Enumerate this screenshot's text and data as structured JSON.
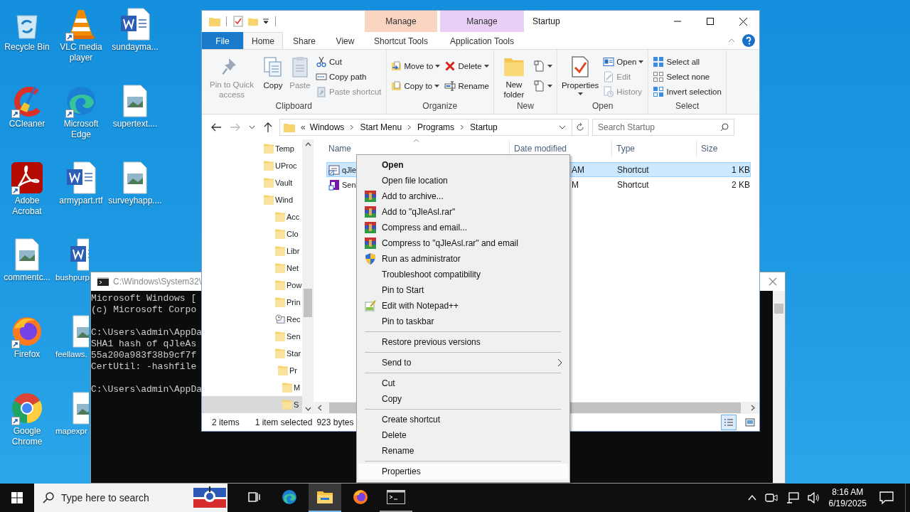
{
  "desktop_icons": [
    {
      "label": "Recycle Bin",
      "kind": "recycle",
      "shortcut": false
    },
    {
      "label": "CCleaner",
      "kind": "ccleaner",
      "shortcut": true
    },
    {
      "label": "Adobe Acrobat",
      "kind": "acrobat",
      "shortcut": true
    },
    {
      "label": "commentc...",
      "kind": "image",
      "shortcut": false
    },
    {
      "label": "Firefox",
      "kind": "firefox",
      "shortcut": true
    },
    {
      "label": "Google Chrome",
      "kind": "chrome",
      "shortcut": true
    },
    {
      "label": "VLC media player",
      "kind": "vlc",
      "shortcut": true
    },
    {
      "label": "Microsoft Edge",
      "kind": "edge",
      "shortcut": true
    },
    {
      "label": "armypart.rtf",
      "kind": "word",
      "shortcut": false
    },
    {
      "label": "bushpurp",
      "kind": "word",
      "shortcut": false
    },
    {
      "label": "feellaws.",
      "kind": "image",
      "shortcut": false
    },
    {
      "label": "mapexpr",
      "kind": "image",
      "shortcut": false
    },
    {
      "label": "sundayma...",
      "kind": "word",
      "shortcut": false
    },
    {
      "label": "supertext....",
      "kind": "image",
      "shortcut": false
    },
    {
      "label": "surveyhapp....",
      "kind": "image",
      "shortcut": false
    }
  ],
  "cmd_window": {
    "title": "C:\\Windows\\System32\\",
    "blocks": [
      [
        "Microsoft Windows [",
        "(c) Microsoft Corpo"
      ],
      [
        "C:\\Users\\admin\\AppDa",
        "SHA1 hash of qJleAs",
        "55a200a983f38b9cf7f",
        "CertUtil: -hashfile"
      ],
      [
        "C:\\Users\\admin\\AppDa"
      ]
    ]
  },
  "explorer": {
    "title": "Startup",
    "tabs": [
      {
        "label": "File",
        "kind": "file",
        "selected": false
      },
      {
        "label": "Home",
        "kind": "tab",
        "selected": true
      },
      {
        "label": "Share",
        "kind": "tab",
        "selected": false
      },
      {
        "label": "View",
        "kind": "tab",
        "selected": false
      },
      {
        "label": "Shortcut Tools",
        "kind": "context",
        "header": "Manage",
        "color": "#fad5c2",
        "selected": false
      },
      {
        "label": "Application Tools",
        "kind": "context",
        "header": "Manage",
        "color": "#ead0f7",
        "selected": false
      }
    ],
    "ribbon": {
      "groups": [
        {
          "label": "Clipboard",
          "buttons": [
            {
              "label": "Pin to Quick access",
              "kind": "pin",
              "disabled": true
            },
            {
              "label": "Copy",
              "kind": "copy",
              "disabled": false
            },
            {
              "label": "Paste",
              "kind": "paste",
              "disabled": true
            },
            {
              "label": "Cut",
              "kind": "cut",
              "disabled": false
            },
            {
              "label": "Copy path",
              "kind": "copypath",
              "disabled": false
            },
            {
              "label": "Paste shortcut",
              "kind": "pasteshortcut",
              "disabled": true
            }
          ]
        },
        {
          "label": "Organize",
          "buttons": [
            {
              "label": "Move to",
              "kind": "moveto",
              "dropdown": true,
              "disabled": false
            },
            {
              "label": "Copy to",
              "kind": "copyto",
              "dropdown": true,
              "disabled": false
            },
            {
              "label": "Delete",
              "kind": "delete",
              "dropdown": true,
              "disabled": false
            },
            {
              "label": "Rename",
              "kind": "rename",
              "disabled": false
            }
          ]
        },
        {
          "label": "New",
          "buttons": [
            {
              "label": "New folder",
              "kind": "newfolder",
              "disabled": false
            },
            {
              "kind": "newitem",
              "dropdown": true,
              "disabled": false
            },
            {
              "kind": "easyaccess",
              "dropdown": true,
              "disabled": false
            }
          ]
        },
        {
          "label": "Open",
          "buttons": [
            {
              "label": "Properties",
              "kind": "properties",
              "dropdown": true,
              "disabled": false
            },
            {
              "label": "Open",
              "kind": "open",
              "dropdown": true,
              "disabled": false
            },
            {
              "label": "Edit",
              "kind": "edit",
              "disabled": true
            },
            {
              "label": "History",
              "kind": "history",
              "disabled": true
            }
          ]
        },
        {
          "label": "Select",
          "buttons": [
            {
              "label": "Select all",
              "kind": "selectall",
              "disabled": false
            },
            {
              "label": "Select none",
              "kind": "selectnone",
              "disabled": false
            },
            {
              "label": "Invert selection",
              "kind": "invert",
              "disabled": false
            }
          ]
        }
      ]
    },
    "address": {
      "overflow_mark": "«",
      "crumbs": [
        "Windows",
        "Start Menu",
        "Programs",
        "Startup"
      ],
      "search_placeholder": "Search Startup"
    },
    "nav_tree": [
      {
        "label": "Temp",
        "kind": "folder",
        "selected": false
      },
      {
        "label": "UProc",
        "kind": "folder",
        "selected": false
      },
      {
        "label": "Vault",
        "kind": "folder",
        "selected": false
      },
      {
        "label": "Wind",
        "kind": "folder",
        "selected": false,
        "children": [
          {
            "label": "Acc",
            "kind": "folder",
            "selected": false
          },
          {
            "label": "Clo",
            "kind": "folder",
            "selected": false
          },
          {
            "label": "Libr",
            "kind": "folder",
            "selected": false
          },
          {
            "label": "Net",
            "kind": "folder",
            "selected": false
          },
          {
            "label": "Pow",
            "kind": "folder",
            "selected": false
          },
          {
            "label": "Prin",
            "kind": "folder",
            "selected": false
          },
          {
            "label": "Rec",
            "kind": "recent",
            "selected": false
          },
          {
            "label": "Sen",
            "kind": "folder",
            "selected": false
          },
          {
            "label": "Star",
            "kind": "folder",
            "selected": false,
            "children": [
              {
                "label": "Pr",
                "kind": "folder",
                "selected": false,
                "children": [
                  {
                    "label": "M",
                    "kind": "folder",
                    "selected": false
                  },
                  {
                    "label": "S",
                    "kind": "folder",
                    "selected": true
                  }
                ]
              }
            ]
          }
        ]
      }
    ],
    "columns": [
      "Name",
      "Date modified",
      "Type",
      "Size"
    ],
    "files": [
      {
        "name": "qJle",
        "date": "AM",
        "type": "Shortcut",
        "size": "1 KB",
        "kind": "shortcut",
        "selected": true
      },
      {
        "name": "Sen",
        "date": "M",
        "type": "Shortcut",
        "size": "2 KB",
        "kind": "app",
        "selected": false
      }
    ],
    "status": {
      "count": "2 items",
      "selection": "1 item selected",
      "size": "923 bytes"
    },
    "views": [
      {
        "kind": "details",
        "selected": true
      },
      {
        "kind": "large",
        "selected": false
      }
    ]
  },
  "context_menu": {
    "groups": [
      {
        "items": [
          {
            "label": "Open",
            "kind": "default",
            "selected": false
          },
          {
            "label": "Open file location",
            "kind": "plain",
            "selected": false
          },
          {
            "label": "Add to archive...",
            "kind": "archive",
            "selected": false
          },
          {
            "label": "Add to \"qJleAsl.rar\"",
            "kind": "archive",
            "selected": false
          },
          {
            "label": "Compress and email...",
            "kind": "archive",
            "selected": false
          },
          {
            "label": "Compress to \"qJleAsl.rar\" and email",
            "kind": "archive",
            "selected": false
          },
          {
            "label": "Run as administrator",
            "kind": "admin",
            "selected": false
          },
          {
            "label": "Troubleshoot compatibility",
            "kind": "plain",
            "selected": false
          },
          {
            "label": "Pin to Start",
            "kind": "plain",
            "selected": false
          },
          {
            "label": "Edit with Notepad++",
            "kind": "editor",
            "selected": false
          },
          {
            "label": "Pin to taskbar",
            "kind": "plain",
            "selected": false
          }
        ]
      },
      {
        "items": [
          {
            "label": "Restore previous versions",
            "kind": "plain",
            "selected": false
          }
        ]
      },
      {
        "items": [
          {
            "label": "Send to",
            "kind": "submenu",
            "selected": false
          }
        ]
      },
      {
        "items": [
          {
            "label": "Cut",
            "kind": "plain",
            "selected": false
          },
          {
            "label": "Copy",
            "kind": "plain",
            "selected": false
          }
        ]
      },
      {
        "items": [
          {
            "label": "Create shortcut",
            "kind": "plain",
            "selected": false
          },
          {
            "label": "Delete",
            "kind": "plain",
            "selected": false
          },
          {
            "label": "Rename",
            "kind": "plain",
            "selected": false
          }
        ]
      },
      {
        "items": [
          {
            "label": "Properties",
            "kind": "plain",
            "selected": true
          }
        ]
      }
    ]
  },
  "taskbar": {
    "search_placeholder": "Type here to search",
    "apps": [
      {
        "kind": "taskview",
        "selected": false,
        "running": false
      },
      {
        "kind": "edge",
        "selected": false,
        "running": false
      },
      {
        "kind": "explorer",
        "selected": true,
        "running": true
      },
      {
        "kind": "firefox",
        "selected": false,
        "running": false
      },
      {
        "kind": "terminal",
        "selected": false,
        "running": true
      }
    ],
    "time": "8:16 AM",
    "date": "6/19/2025"
  }
}
